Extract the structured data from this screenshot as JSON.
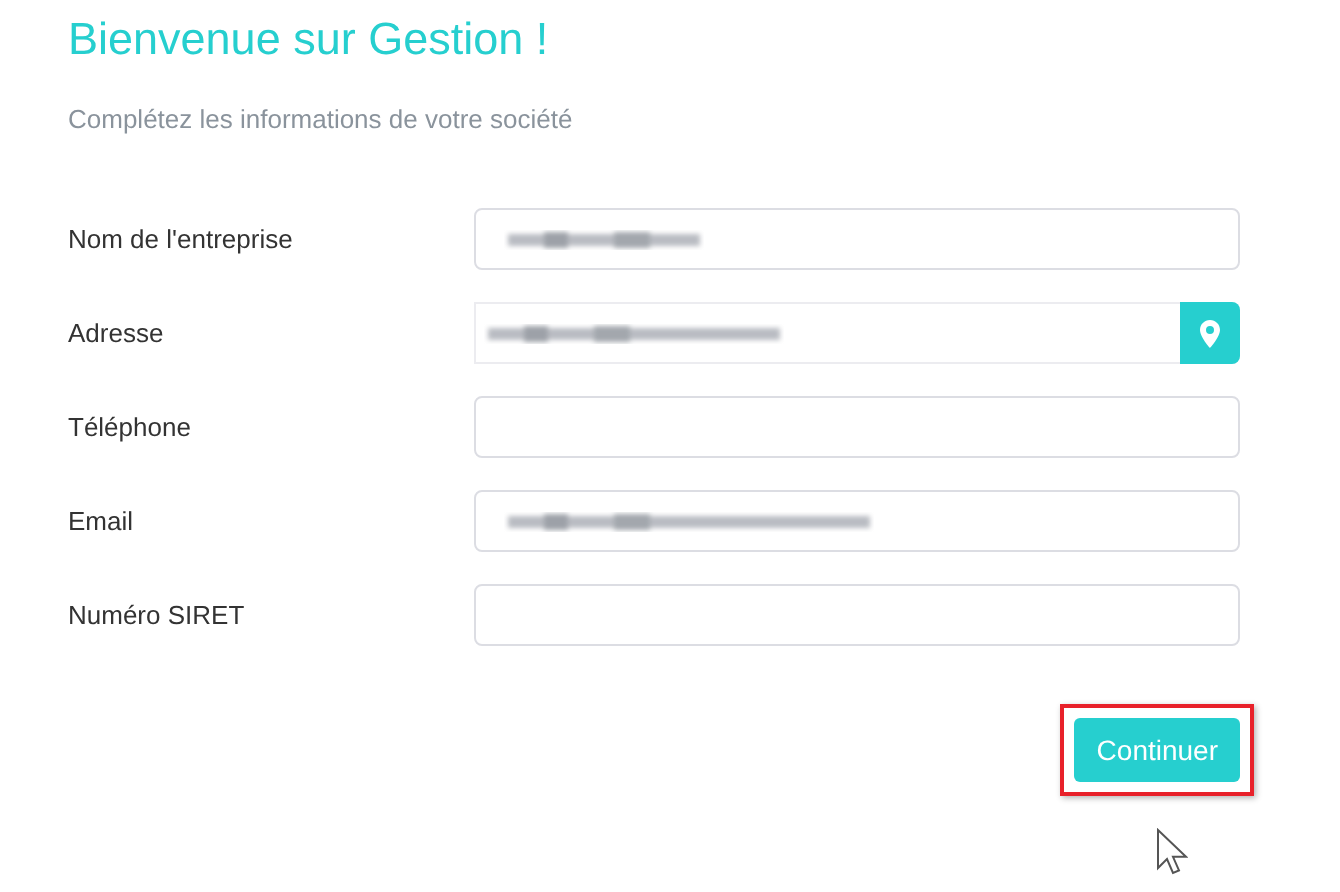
{
  "title": "Bienvenue sur Gestion !",
  "subtitle": "Complétez les informations de votre société",
  "fields": [
    {
      "label": "Nom de l'entreprise",
      "redacted": true,
      "kind": "text"
    },
    {
      "label": "Adresse",
      "redacted": true,
      "kind": "location"
    },
    {
      "label": "Téléphone",
      "redacted": false,
      "kind": "text"
    },
    {
      "label": "Email",
      "redacted": true,
      "kind": "text"
    },
    {
      "label": "Numéro SIRET",
      "redacted": false,
      "kind": "text"
    }
  ],
  "button": {
    "label": "Continuer",
    "highlighted": true
  }
}
